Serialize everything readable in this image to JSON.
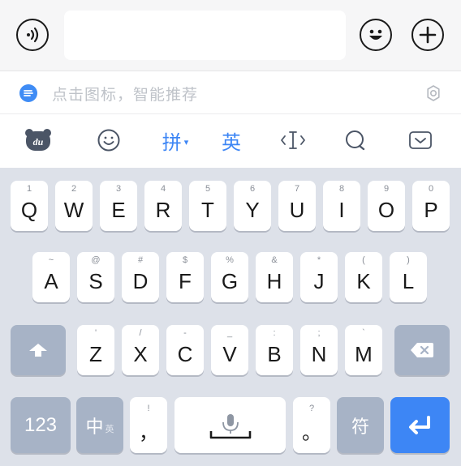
{
  "input_bar": {
    "voice_icon": "voice-waves-icon",
    "emoji_icon": "emoji-face-icon",
    "plus_icon": "plus-icon",
    "text_value": ""
  },
  "suggest_strip": {
    "hint": "点击图标，智能推荐",
    "badge_icon": "du-logo-icon",
    "settings_icon": "gear-icon"
  },
  "toolbar": {
    "items": [
      {
        "name": "du-bear-icon"
      },
      {
        "name": "smiley-icon"
      },
      {
        "label": "拼",
        "caret": "▾"
      },
      {
        "label": "英"
      },
      {
        "name": "text-cursor-icon"
      },
      {
        "name": "search-icon"
      },
      {
        "name": "hide-keyboard-icon"
      }
    ],
    "accent_color": "#3d86f5"
  },
  "keyboard": {
    "row1": [
      {
        "key": "Q",
        "sub": "1"
      },
      {
        "key": "W",
        "sub": "2"
      },
      {
        "key": "E",
        "sub": "3"
      },
      {
        "key": "R",
        "sub": "4"
      },
      {
        "key": "T",
        "sub": "5"
      },
      {
        "key": "Y",
        "sub": "6"
      },
      {
        "key": "U",
        "sub": "7"
      },
      {
        "key": "I",
        "sub": "8"
      },
      {
        "key": "O",
        "sub": "9"
      },
      {
        "key": "P",
        "sub": "0"
      }
    ],
    "row2": [
      {
        "key": "A",
        "sub": "~"
      },
      {
        "key": "S",
        "sub": "@"
      },
      {
        "key": "D",
        "sub": "#"
      },
      {
        "key": "F",
        "sub": "$"
      },
      {
        "key": "G",
        "sub": "%"
      },
      {
        "key": "H",
        "sub": "&"
      },
      {
        "key": "J",
        "sub": "*"
      },
      {
        "key": "K",
        "sub": "("
      },
      {
        "key": "L",
        "sub": ")"
      }
    ],
    "row3": [
      {
        "key": "Z",
        "sub": "'"
      },
      {
        "key": "X",
        "sub": "/"
      },
      {
        "key": "C",
        "sub": "-"
      },
      {
        "key": "V",
        "sub": "_"
      },
      {
        "key": "B",
        "sub": ":"
      },
      {
        "key": "N",
        "sub": ";"
      },
      {
        "key": "M",
        "sub": "`"
      }
    ],
    "bottom": {
      "num_label": "123",
      "lang_main": "中",
      "lang_sub": "英",
      "comma": "，",
      "comma_sub": "!",
      "period": "。",
      "period_sub": "?",
      "symbol_label": "符"
    },
    "fn_color": "#a7b3c6",
    "enter_color": "#3d86f5"
  }
}
